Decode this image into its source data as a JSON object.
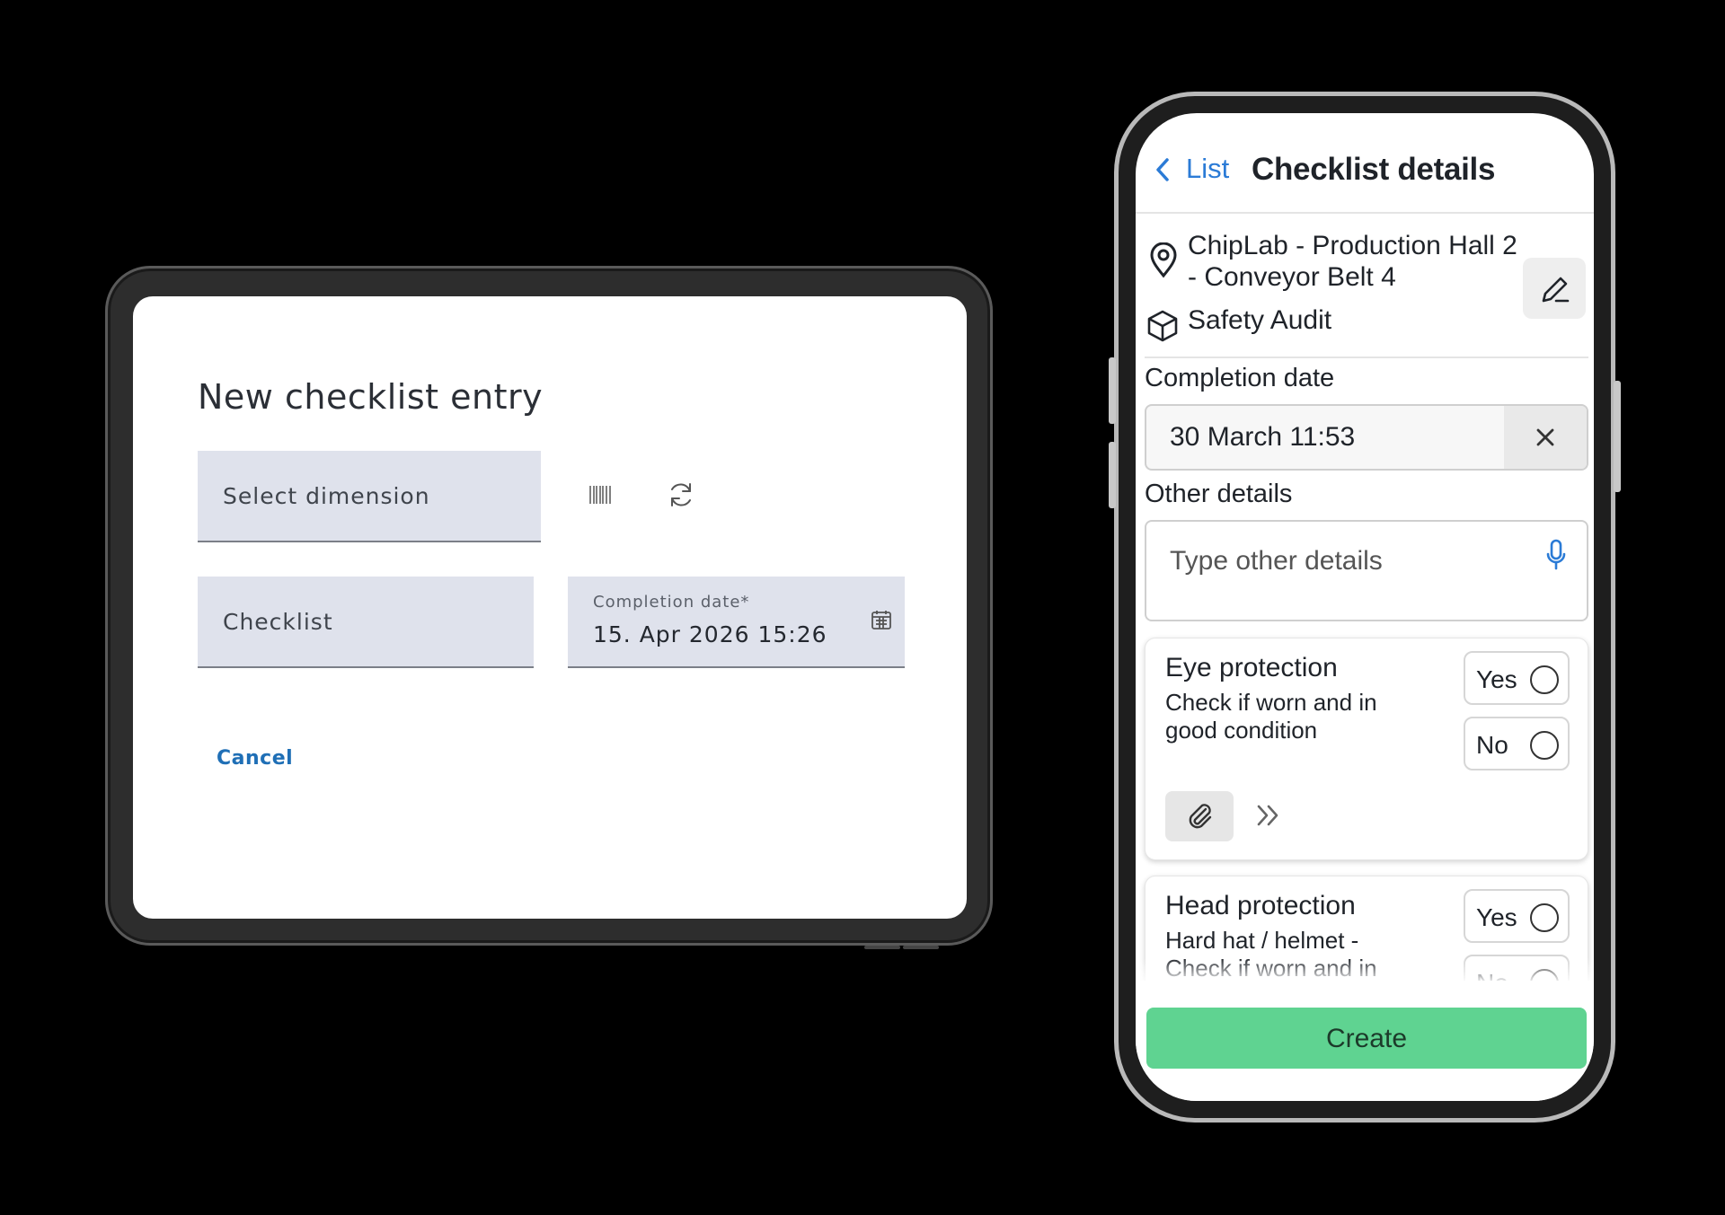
{
  "tablet": {
    "title": "New checklist entry",
    "dimension_placeholder": "Select dimension",
    "checklist_placeholder": "Checklist",
    "completion_label": "Completion date*",
    "completion_value": "15. Apr 2026 15:26",
    "cancel_label": "Cancel",
    "icons": [
      "barcode-icon",
      "refresh-icon",
      "calendar-icon"
    ]
  },
  "phone": {
    "back_label": "List",
    "title": "Checklist details",
    "location": "ChipLab - Production Hall 2  - Conveyor Belt 4",
    "checklist_type": "Safety Audit",
    "completion_label": "Completion date",
    "completion_value": "30 March 11:53",
    "other_details_label": "Other details",
    "other_details_placeholder": "Type other details",
    "items": [
      {
        "title": "Eye protection",
        "description": "Check if worn and in good condition",
        "yes": "Yes",
        "no": "No"
      },
      {
        "title": "Head protection",
        "description": "Hard hat / helmet - Check if worn and in good",
        "yes": "Yes",
        "no": "No"
      }
    ],
    "create_label": "Create",
    "accent_color": "#2b7bd6",
    "create_color": "#5fd391"
  }
}
